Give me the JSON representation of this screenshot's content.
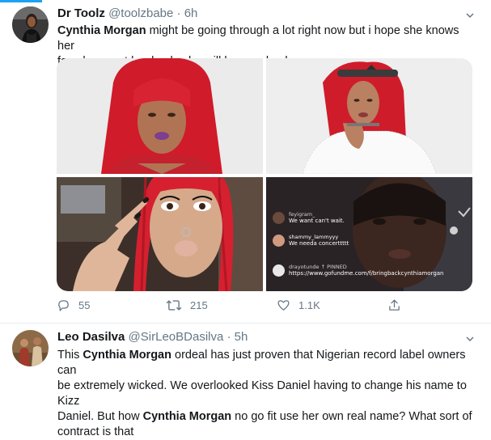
{
  "tweet1": {
    "display_name": "Dr Toolz",
    "handle": "@toolzbabe",
    "separator": "·",
    "time": "6h",
    "body": {
      "mention": "Cynthia Morgan",
      "text_line1": " might be going through a lot right now but i hope she knows her",
      "text_line2": "fans have got her back, she will bounce back"
    },
    "live_comments": [
      {
        "user": "feyigram_",
        "message": "We want can't wait."
      },
      {
        "user": "shammy_lammyyy",
        "message": "We needa concerttttt"
      },
      {
        "user": "drayotunde",
        "pinned_label": "PINNED",
        "message": "https://www.gofundme.com/f/bringbackcynthiamorgan"
      }
    ],
    "actions": {
      "reply_count": "55",
      "retweet_count": "215",
      "like_count": "1.1K"
    }
  },
  "tweet2": {
    "display_name": "Leo Dasilva",
    "handle": "@SirLeoBDasilva",
    "separator": "·",
    "time": "5h",
    "body": {
      "l1_a": "This ",
      "l1_mention": "Cynthia Morgan",
      "l1_b": " ordeal has just proven that Nigerian record label owners can",
      "l2": "be extremely wicked. We overlooked Kiss Daniel having to change his name to Kizz",
      "l3_a": "Daniel. But how ",
      "l3_mention": "Cynthia Morgan",
      "l3_b": " no go fit use her own real name? What sort of",
      "l4": "contract is that"
    }
  },
  "colors": {
    "accent": "#1da1f2",
    "text": "#14171a",
    "muted": "#657786",
    "hair_red": "#d01b2a"
  },
  "icons": [
    "chevron-down-icon",
    "reply-icon",
    "retweet-icon",
    "like-icon",
    "share-icon"
  ]
}
